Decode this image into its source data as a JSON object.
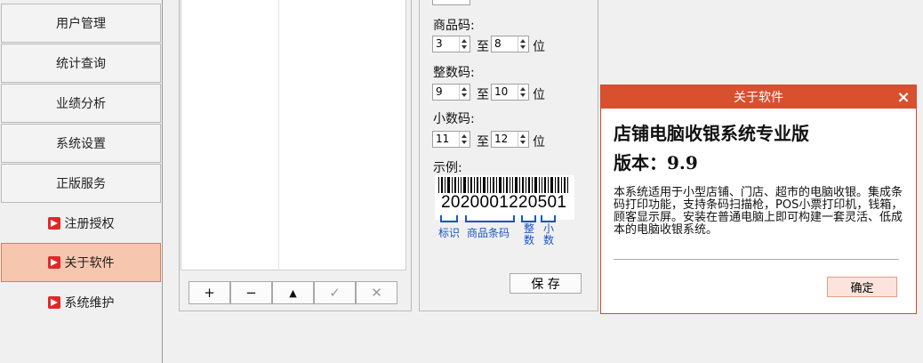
{
  "sidebar": {
    "items": [
      {
        "label": "用户管理"
      },
      {
        "label": "统计查询"
      },
      {
        "label": "业绩分析"
      },
      {
        "label": "系统设置"
      },
      {
        "label": "正版服务"
      }
    ],
    "subitems": [
      {
        "label": "注册授权",
        "icon": "red-arrow-icon"
      },
      {
        "label": "关于软件",
        "icon": "red-arrow-icon",
        "active": true
      },
      {
        "label": "系统维护",
        "icon": "red-arrow-icon"
      }
    ]
  },
  "toolbar": {
    "add": "+",
    "remove": "−",
    "up": "▲",
    "confirm": "✓",
    "cancel": "✕"
  },
  "settings": {
    "product_code_label": "商品码:",
    "product_from": "3",
    "product_to": "8",
    "integer_code_label": "整数码:",
    "integer_from": "9",
    "integer_to": "10",
    "decimal_code_label": "小数码:",
    "decimal_from": "11",
    "decimal_to": "12",
    "to_label": "至",
    "unit_label": "位",
    "example_label": "示例:",
    "barcode_digits": "2020001220501",
    "legend": {
      "mark": "标识",
      "product": "商品条码",
      "integer": "整数",
      "decimal": "小数"
    },
    "save_label": "保 存"
  },
  "dialog": {
    "title": "关于软件",
    "close": "×",
    "product_name": "店铺电脑收银系统专业版",
    "version": "版本：9.9",
    "description": "本系统适用于小型店铺、门店、超市的电脑收银。集成条码打印功能，支持条码扫描枪，POS小票打印机，钱箱，顾客显示屏。安装在普通电脑上即可构建一套灵活、低成本的电脑收银系统。",
    "ok_label": "确定"
  },
  "colors": {
    "accent": "#d9502e",
    "active_bg": "#f7c6ae",
    "legend_blue": "#1a55c8"
  }
}
